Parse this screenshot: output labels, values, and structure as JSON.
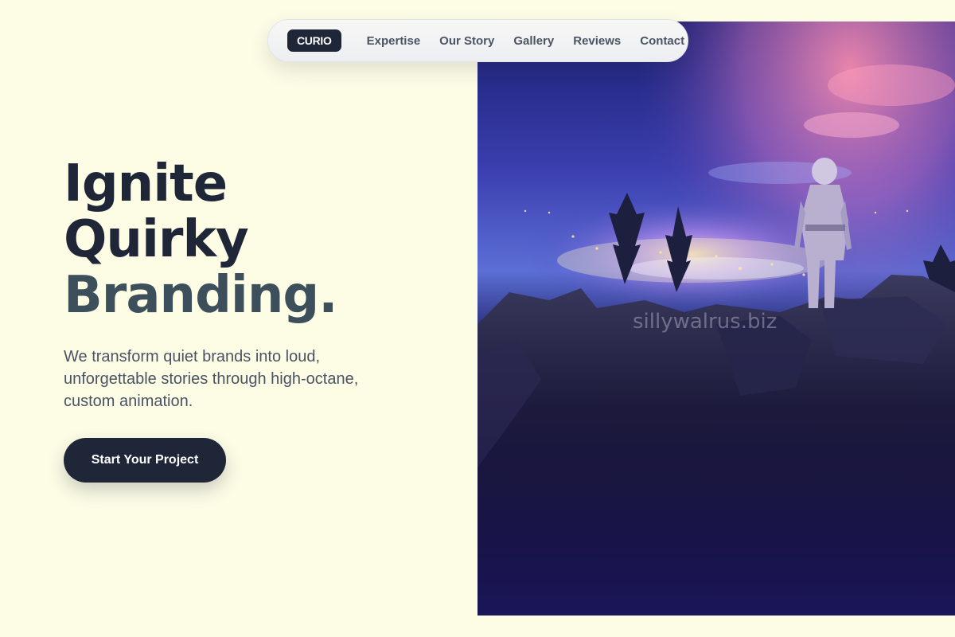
{
  "nav": {
    "logo": "CURIO",
    "links": [
      {
        "label": "Expertise"
      },
      {
        "label": "Our Story"
      },
      {
        "label": "Gallery"
      },
      {
        "label": "Reviews"
      },
      {
        "label": "Contact"
      }
    ]
  },
  "hero": {
    "headline": [
      "Ignite",
      "Quirky",
      "Branding."
    ],
    "subtext": "We transform quiet brands into loud, unforgettable stories through high-octane, custom animation.",
    "cta_label": "Start Your Project"
  },
  "image": {
    "description_icon": "astronaut-over-city-night-image",
    "watermark": "sillywalrus.biz"
  },
  "colors": {
    "background": "#fdfde6",
    "primary": "#1e2637",
    "accent_text": "#3e4f5c",
    "body_text": "#4a5363"
  }
}
